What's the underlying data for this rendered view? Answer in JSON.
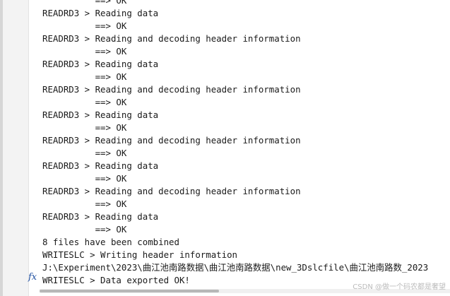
{
  "console": {
    "lines": [
      "          ==> OK",
      "READRD3 > Reading data",
      "          ==> OK",
      "READRD3 > Reading and decoding header information",
      "          ==> OK",
      "READRD3 > Reading data",
      "          ==> OK",
      "READRD3 > Reading and decoding header information",
      "          ==> OK",
      "READRD3 > Reading data",
      "          ==> OK",
      "READRD3 > Reading and decoding header information",
      "          ==> OK",
      "READRD3 > Reading data",
      "          ==> OK",
      "READRD3 > Reading and decoding header information",
      "          ==> OK",
      "READRD3 > Reading data",
      "          ==> OK",
      "8 files have been combined",
      "WRITESLC > Writing header information",
      "J:\\Experiment\\2023\\曲江池南路数据\\曲江池南路数据\\new_3Dslcfile\\曲江池南路数_2023",
      "WRITESLC > Data exported OK!"
    ]
  },
  "prompt": {
    "icon": "fx-icon",
    "glyph": "fx"
  },
  "watermark": {
    "text": "CSDN @做一个码农都是奢望"
  }
}
